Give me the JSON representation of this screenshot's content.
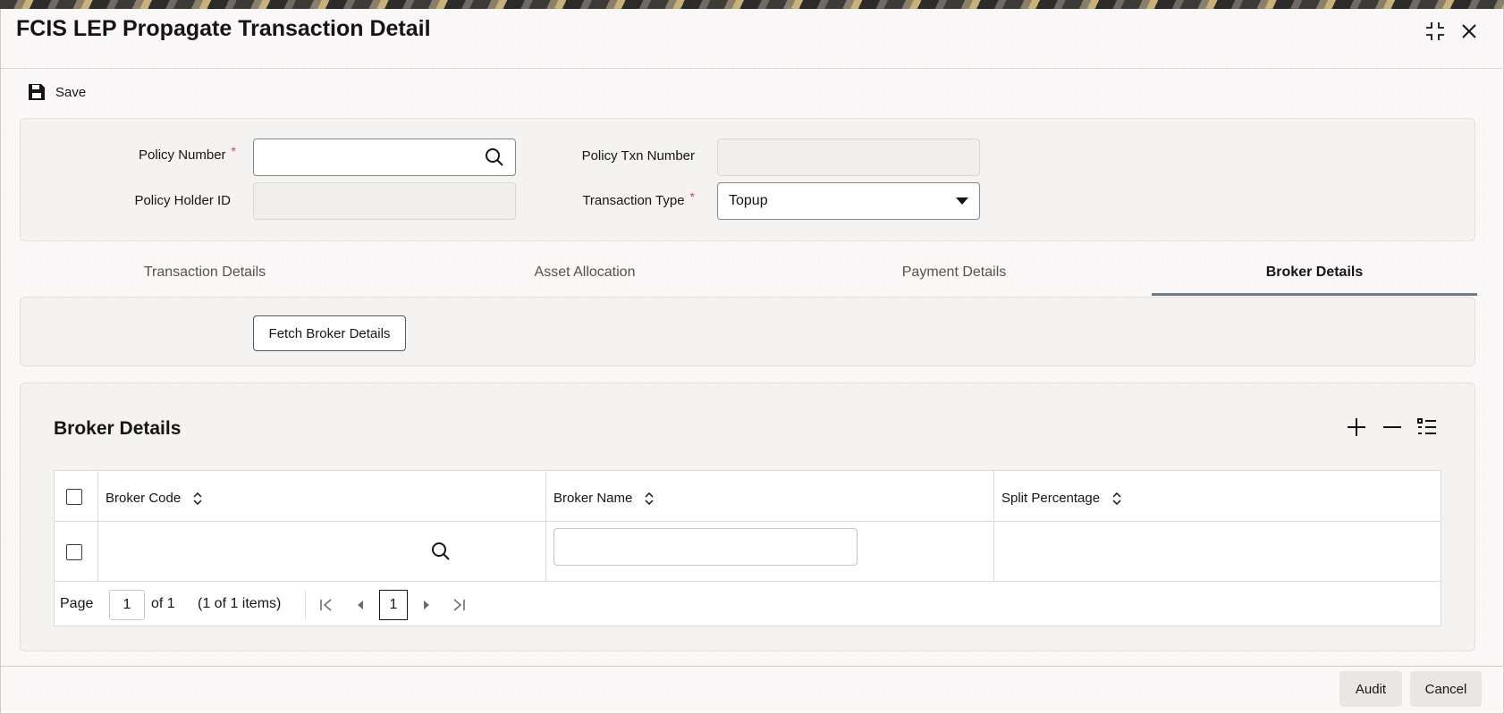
{
  "window": {
    "title": "FCIS LEP Propagate Transaction Detail"
  },
  "toolbar": {
    "save_label": "Save"
  },
  "form": {
    "policy_number_label": "Policy Number",
    "policy_number_value": "",
    "policy_holder_id_label": "Policy Holder ID",
    "policy_holder_id_value": "",
    "policy_txn_number_label": "Policy Txn Number",
    "policy_txn_number_value": "",
    "transaction_type_label": "Transaction Type",
    "transaction_type_value": "Topup",
    "required_mark": "*"
  },
  "tabs": [
    {
      "label": "Transaction Details",
      "active": false
    },
    {
      "label": "Asset Allocation",
      "active": false
    },
    {
      "label": "Payment Details",
      "active": false
    },
    {
      "label": "Broker Details",
      "active": true
    }
  ],
  "fetch_button_label": "Fetch Broker Details",
  "broker_section": {
    "title": "Broker Details",
    "columns": [
      "Broker Code",
      "Broker Name",
      "Split Percentage"
    ],
    "rows": [
      {
        "broker_code": "",
        "broker_name": "",
        "split_percentage": ""
      }
    ]
  },
  "pager": {
    "page_label": "Page",
    "page_value": "1",
    "of_label": "of 1",
    "items_label": "(1 of 1 items)",
    "current_page": "1"
  },
  "footer": {
    "audit_label": "Audit",
    "cancel_label": "Cancel"
  },
  "colors": {
    "accent_tab": "#6f7b85",
    "required": "#c74634"
  }
}
